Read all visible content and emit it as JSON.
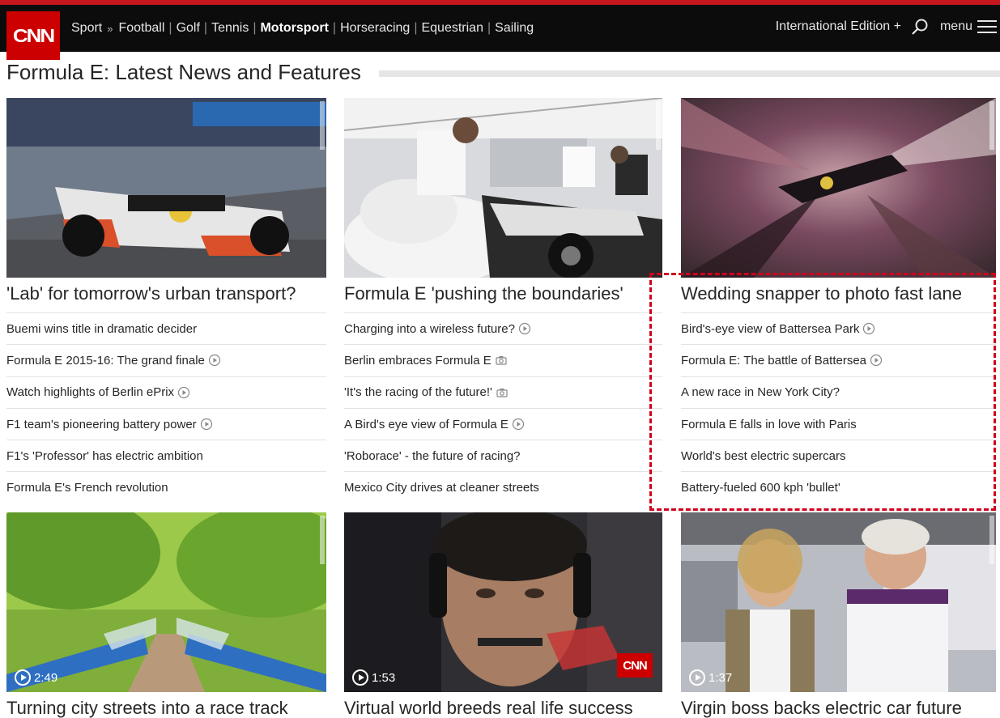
{
  "nav": {
    "logo": "CNN",
    "section": "Sport",
    "crumb_sep": "»",
    "links": [
      "Football",
      "Golf",
      "Tennis",
      "Motorsport",
      "Horseracing",
      "Equestrian",
      "Sailing"
    ],
    "active": "Motorsport",
    "edition": "International Edition +",
    "menu_label": "menu"
  },
  "page": {
    "title": "Formula E: Latest News and Features"
  },
  "columns": [
    {
      "headline": "'Lab' for tomorrow's urban transport?",
      "links": [
        {
          "text": "Buemi wins title in dramatic decider",
          "media": ""
        },
        {
          "text": "Formula E 2015-16: The grand finale",
          "media": "video"
        },
        {
          "text": "Watch highlights of Berlin ePrix",
          "media": "video"
        },
        {
          "text": "F1 team's pioneering battery power",
          "media": "video"
        },
        {
          "text": "F1's 'Professor' has electric ambition",
          "media": ""
        },
        {
          "text": "Formula E's French revolution",
          "media": ""
        }
      ]
    },
    {
      "headline": "Formula E 'pushing the boundaries'",
      "links": [
        {
          "text": "Charging into a wireless future?",
          "media": "video"
        },
        {
          "text": "Berlin embraces Formula E",
          "media": "gallery"
        },
        {
          "text": "'It's the racing of the future!'",
          "media": "gallery"
        },
        {
          "text": "A Bird's eye view of Formula E",
          "media": "video"
        },
        {
          "text": "'Roborace' - the future of racing?",
          "media": ""
        },
        {
          "text": "Mexico City drives at cleaner streets",
          "media": ""
        }
      ]
    },
    {
      "headline": "Wedding snapper to photo fast lane",
      "links": [
        {
          "text": "Bird's-eye view of Battersea Park",
          "media": "video"
        },
        {
          "text": "Formula E: The battle of Battersea",
          "media": "video"
        },
        {
          "text": "A new race in New York City?",
          "media": ""
        },
        {
          "text": "Formula E falls in love with Paris",
          "media": ""
        },
        {
          "text": "World's best electric supercars",
          "media": ""
        },
        {
          "text": "Battery-fueled 600 kph 'bullet'",
          "media": ""
        }
      ]
    }
  ],
  "videos": [
    {
      "duration": "2:49",
      "headline": "Turning city streets into a race track"
    },
    {
      "duration": "1:53",
      "headline": "Virtual world breeds real life success",
      "badge": "CNN"
    },
    {
      "duration": "1:37",
      "headline": "Virgin boss backs electric car future"
    }
  ],
  "colors": {
    "brand_red": "#cc0000",
    "nav_bg": "#0c0c0c",
    "highlight_dash": "#d0021b"
  }
}
